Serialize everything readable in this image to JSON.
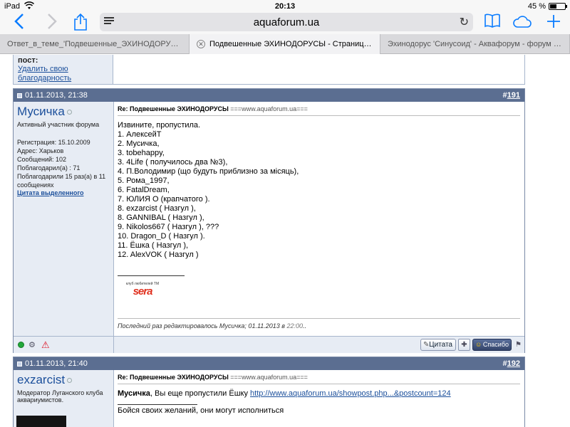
{
  "status": {
    "device": "iPad",
    "time": "20:13",
    "battery": "45 %",
    "battery_level": 0.45
  },
  "toolbar": {
    "url_host": "aquaforum.ua"
  },
  "tabs": [
    {
      "label": "Ответ_в_теме_'Подвешенные_ЭХИНОДОРУСЫ' - v...",
      "active": false
    },
    {
      "label": "Подвешенные ЭХИНОДОРУСЫ - Страница 13 -...",
      "active": true
    },
    {
      "label": "Эхинодорус 'Синусоид' - Аквафорум - форум акв...",
      "active": false
    }
  ],
  "prev_post": {
    "label": "пост:",
    "link": "Удалить свою благодарность"
  },
  "post1": {
    "date": "01.11.2013, 21:38",
    "number_prefix": "#",
    "number": "191",
    "username": "Мусичка",
    "user_title": "Активный участник форума",
    "stats": [
      "Регистрация: 15.10.2009",
      "Адрес: Харьков",
      "Сообщений: 102",
      "Поблагодарил(а) : 71",
      "Поблагодарили 15 раз(а) в 11 сообщениях"
    ],
    "quote_link": "Цитата выделенного",
    "title_bold": "Re: Подвешенные ЭХИНОДОРУСЫ",
    "title_rest": " ===www.aquaforum.ua===",
    "lines": [
      "Извините, пропустила.",
      "1. АлексейТ",
      "2. Мусичка,",
      "3. tobehappy,",
      "3. 4Life ( получилось два №3),",
      "4. П.Володимир (що будуть приблизно за місяць),",
      "5. Рома_1997,",
      "6. FatalDream,",
      "7. ЮЛИЯ О (крапчатого ).",
      "8. exzarcist ( Назгул ),",
      "8. GANNIBAL ( Назгул ),",
      "9. Nikolos667 ( Назгул ), ???",
      "10. Dragon_D ( Назгул ).",
      "11. Ёшка ( Назгул ),",
      "12. AlexVOK ( Назгул )"
    ],
    "sig_small": "клуб любителей ТМ",
    "sig_big": "sera",
    "edited_prefix": "Последний раз редактировалось Мусичка; 01.11.2013 в ",
    "edited_time": "22:00",
    "edited_suffix": "..",
    "quote_btn": "Цитата",
    "thanks_btn": "Спасибо"
  },
  "post2": {
    "date": "01.11.2013, 21:40",
    "number_prefix": "#",
    "number": "192",
    "username": "exzarcist",
    "user_title": "Модератор Луганского клуба аквариумистов.",
    "title_bold": "Re: Подвешенные ЭХИНОДОРУСЫ",
    "title_rest": " ===www.aquaforum.ua===",
    "addressee": "Мусичка",
    "text": ", Вы еще пропустили Ёшку ",
    "link": "http://www.aquaforum.ua/showpost.php...&postcount=124",
    "signature": "Бойся своих желаний, они могут исполниться"
  }
}
